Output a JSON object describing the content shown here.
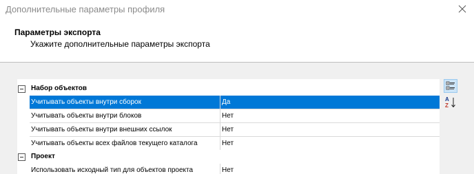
{
  "window": {
    "title": "Дополнительные параметры профиля"
  },
  "header": {
    "title": "Параметры экспорта",
    "subtitle": "Укажите дополнительные параметры экспорта"
  },
  "property_grid": {
    "categories": [
      {
        "label": "Набор объектов",
        "expanded": true,
        "properties": [
          {
            "name": "Учитывать объекты внутри сборок",
            "value": "Да",
            "selected": true
          },
          {
            "name": "Учитывать объекты внутри блоков",
            "value": "Нет",
            "selected": false
          },
          {
            "name": "Учитывать объекты внутри внешних ссылок",
            "value": "Нет",
            "selected": false
          },
          {
            "name": "Учитывать объекты всех файлов текущего каталога",
            "value": "Нет",
            "selected": false
          }
        ]
      },
      {
        "label": "Проект",
        "expanded": true,
        "properties": [
          {
            "name": "Использовать исходный тип для объектов проекта",
            "value": "Нет",
            "selected": false
          }
        ]
      }
    ]
  },
  "toolbar": {
    "categorized_icon": "categorized-view-icon",
    "alphabetical_icon": "sort-alphabetical-icon",
    "sort_letter_top": "A",
    "sort_letter_bottom": "Z"
  },
  "colors": {
    "selection": "#0078d7",
    "grid_line": "#d9d9d9",
    "panel_bg": "#f0f0f0"
  }
}
